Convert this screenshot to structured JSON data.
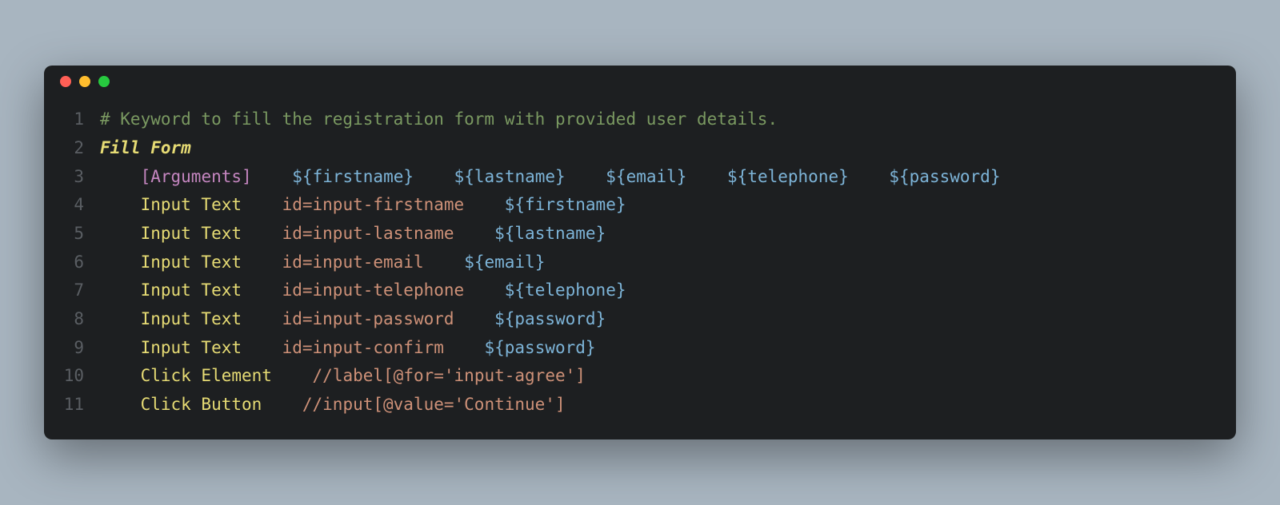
{
  "colors": {
    "red": "#ff5f56",
    "yellow": "#ffbd2e",
    "green": "#27c93f",
    "background": "#1d1f21",
    "pageBackground": "#a8b5c0"
  },
  "lines": [
    {
      "num": "1",
      "tokens": [
        {
          "cls": "comment",
          "text": "# Keyword to fill the registration form with provided user details."
        }
      ]
    },
    {
      "num": "2",
      "tokens": [
        {
          "cls": "keyword-name",
          "text": "Fill Form"
        }
      ]
    },
    {
      "num": "3",
      "tokens": [
        {
          "cls": "white",
          "text": "    "
        },
        {
          "cls": "bracket",
          "text": "["
        },
        {
          "cls": "argument-word",
          "text": "Arguments"
        },
        {
          "cls": "bracket",
          "text": "]"
        },
        {
          "cls": "white",
          "text": "    "
        },
        {
          "cls": "var-brace",
          "text": "${"
        },
        {
          "cls": "var-name",
          "text": "firstname"
        },
        {
          "cls": "var-brace",
          "text": "}"
        },
        {
          "cls": "white",
          "text": "    "
        },
        {
          "cls": "var-brace",
          "text": "${"
        },
        {
          "cls": "var-name",
          "text": "lastname"
        },
        {
          "cls": "var-brace",
          "text": "}"
        },
        {
          "cls": "white",
          "text": "    "
        },
        {
          "cls": "var-brace",
          "text": "${"
        },
        {
          "cls": "var-name",
          "text": "email"
        },
        {
          "cls": "var-brace",
          "text": "}"
        },
        {
          "cls": "white",
          "text": "    "
        },
        {
          "cls": "var-brace",
          "text": "${"
        },
        {
          "cls": "var-name",
          "text": "telephone"
        },
        {
          "cls": "var-brace",
          "text": "}"
        },
        {
          "cls": "white",
          "text": "    "
        },
        {
          "cls": "var-brace",
          "text": "${"
        },
        {
          "cls": "var-name",
          "text": "password"
        },
        {
          "cls": "var-brace",
          "text": "}"
        }
      ]
    },
    {
      "num": "4",
      "tokens": [
        {
          "cls": "white",
          "text": "    "
        },
        {
          "cls": "action",
          "text": "Input Text"
        },
        {
          "cls": "white",
          "text": "    "
        },
        {
          "cls": "locator",
          "text": "id=input-firstname"
        },
        {
          "cls": "white",
          "text": "    "
        },
        {
          "cls": "var-brace",
          "text": "${"
        },
        {
          "cls": "var-name",
          "text": "firstname"
        },
        {
          "cls": "var-brace",
          "text": "}"
        }
      ]
    },
    {
      "num": "5",
      "tokens": [
        {
          "cls": "white",
          "text": "    "
        },
        {
          "cls": "action",
          "text": "Input Text"
        },
        {
          "cls": "white",
          "text": "    "
        },
        {
          "cls": "locator",
          "text": "id=input-lastname"
        },
        {
          "cls": "white",
          "text": "    "
        },
        {
          "cls": "var-brace",
          "text": "${"
        },
        {
          "cls": "var-name",
          "text": "lastname"
        },
        {
          "cls": "var-brace",
          "text": "}"
        }
      ]
    },
    {
      "num": "6",
      "tokens": [
        {
          "cls": "white",
          "text": "    "
        },
        {
          "cls": "action",
          "text": "Input Text"
        },
        {
          "cls": "white",
          "text": "    "
        },
        {
          "cls": "locator",
          "text": "id=input-email"
        },
        {
          "cls": "white",
          "text": "    "
        },
        {
          "cls": "var-brace",
          "text": "${"
        },
        {
          "cls": "var-name",
          "text": "email"
        },
        {
          "cls": "var-brace",
          "text": "}"
        }
      ]
    },
    {
      "num": "7",
      "tokens": [
        {
          "cls": "white",
          "text": "    "
        },
        {
          "cls": "action",
          "text": "Input Text"
        },
        {
          "cls": "white",
          "text": "    "
        },
        {
          "cls": "locator",
          "text": "id=input-telephone"
        },
        {
          "cls": "white",
          "text": "    "
        },
        {
          "cls": "var-brace",
          "text": "${"
        },
        {
          "cls": "var-name",
          "text": "telephone"
        },
        {
          "cls": "var-brace",
          "text": "}"
        }
      ]
    },
    {
      "num": "8",
      "tokens": [
        {
          "cls": "white",
          "text": "    "
        },
        {
          "cls": "action",
          "text": "Input Text"
        },
        {
          "cls": "white",
          "text": "    "
        },
        {
          "cls": "locator",
          "text": "id=input-password"
        },
        {
          "cls": "white",
          "text": "    "
        },
        {
          "cls": "var-brace",
          "text": "${"
        },
        {
          "cls": "var-name",
          "text": "password"
        },
        {
          "cls": "var-brace",
          "text": "}"
        }
      ]
    },
    {
      "num": "9",
      "tokens": [
        {
          "cls": "white",
          "text": "    "
        },
        {
          "cls": "action",
          "text": "Input Text"
        },
        {
          "cls": "white",
          "text": "    "
        },
        {
          "cls": "locator",
          "text": "id=input-confirm"
        },
        {
          "cls": "white",
          "text": "    "
        },
        {
          "cls": "var-brace",
          "text": "${"
        },
        {
          "cls": "var-name",
          "text": "password"
        },
        {
          "cls": "var-brace",
          "text": "}"
        }
      ]
    },
    {
      "num": "10",
      "tokens": [
        {
          "cls": "white",
          "text": "    "
        },
        {
          "cls": "action",
          "text": "Click Element"
        },
        {
          "cls": "white",
          "text": "    "
        },
        {
          "cls": "locator",
          "text": "//label[@for='input-agree']"
        }
      ]
    },
    {
      "num": "11",
      "tokens": [
        {
          "cls": "white",
          "text": "    "
        },
        {
          "cls": "action",
          "text": "Click Button"
        },
        {
          "cls": "white",
          "text": "    "
        },
        {
          "cls": "locator",
          "text": "//input[@value='Continue']"
        }
      ]
    }
  ]
}
